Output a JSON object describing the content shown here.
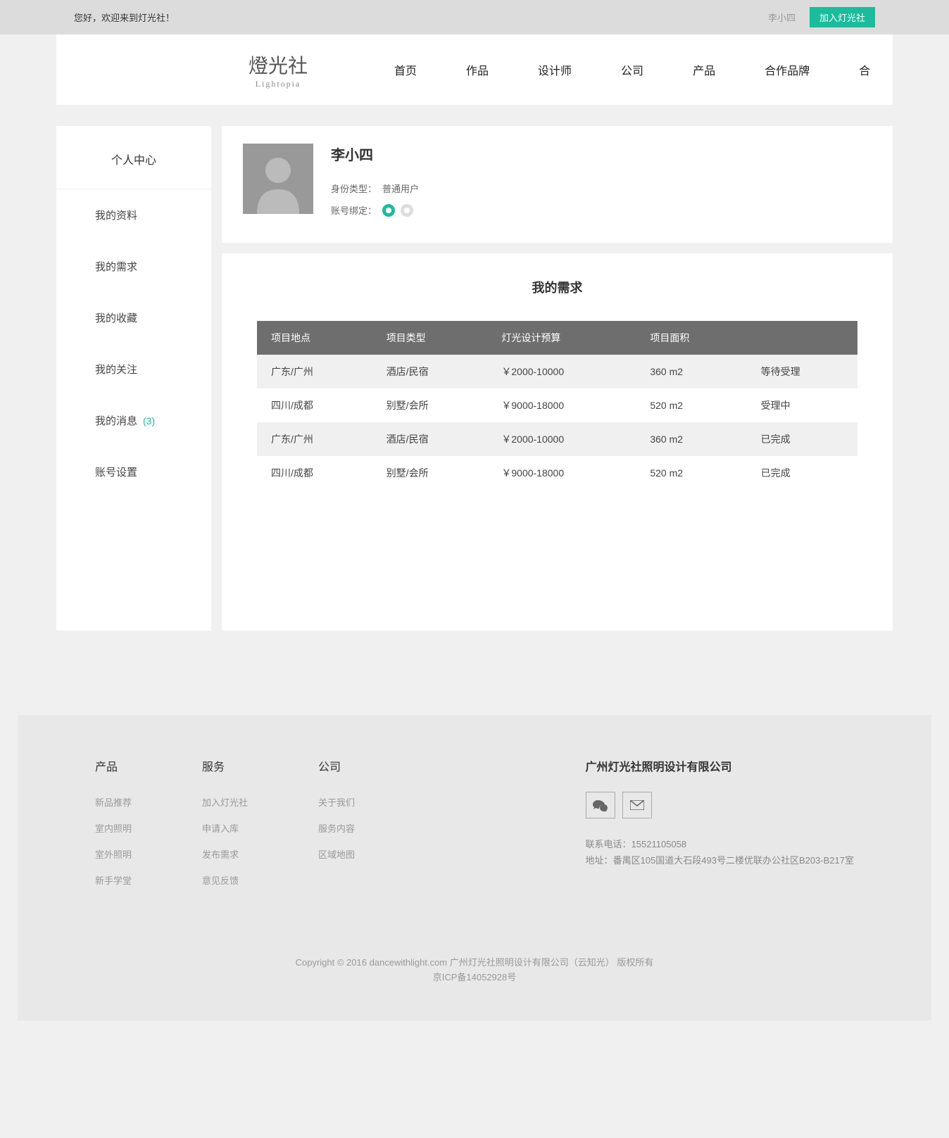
{
  "topbar": {
    "welcome": "您好，欢迎来到灯光社！",
    "username": "李小四",
    "join_btn": "加入灯光社"
  },
  "logo": {
    "main": "燈光社",
    "sub": "Lightopia"
  },
  "nav": [
    "首页",
    "作品",
    "设计师",
    "公司",
    "产品",
    "合作品牌",
    "合"
  ],
  "sidebar": {
    "title": "个人中心",
    "items": [
      {
        "label": "我的资料"
      },
      {
        "label": "我的需求"
      },
      {
        "label": "我的收藏"
      },
      {
        "label": "我的关注"
      },
      {
        "label": "我的消息",
        "badge": "(3)"
      },
      {
        "label": "账号设置"
      }
    ]
  },
  "profile": {
    "name": "李小四",
    "identity_label": "身份类型：",
    "identity_value": "普通用户",
    "bind_label": "账号绑定：",
    "bind_wechat": "wechat-icon",
    "bind_qq": "qq-icon"
  },
  "section_title": "我的需求",
  "table": {
    "headers": [
      "项目地点",
      "项目类型",
      "灯光设计预算",
      "项目面积",
      ""
    ],
    "rows": [
      {
        "location": "广东/广州",
        "type": "酒店/民宿",
        "budget": "￥2000-10000",
        "area": "360 m2",
        "status": "等待受理"
      },
      {
        "location": "四川/成都",
        "type": "别墅/会所",
        "budget": "￥9000-18000",
        "area": "520 m2",
        "status": "受理中"
      },
      {
        "location": "广东/广州",
        "type": "酒店/民宿",
        "budget": "￥2000-10000",
        "area": "360 m2",
        "status": "已完成"
      },
      {
        "location": "四川/成都",
        "type": "别墅/会所",
        "budget": "￥9000-18000",
        "area": "520 m2",
        "status": "已完成"
      }
    ]
  },
  "footer": {
    "cols": [
      {
        "title": "产品",
        "links": [
          "新品推荐",
          "室内照明",
          "室外照明",
          "新手学堂"
        ]
      },
      {
        "title": "服务",
        "links": [
          "加入灯光社",
          "申请入库",
          "发布需求",
          "意见反馈"
        ]
      },
      {
        "title": "公司",
        "links": [
          "关于我们",
          "服务内容",
          "区域地图"
        ]
      }
    ],
    "company": {
      "title": "广州灯光社照明设计有限公司",
      "phone_label": "联系电话：",
      "phone": "15521105058",
      "address_label": "地址：",
      "address": "番禺区105国道大石段493号二楼优联办公社区B203-B217室"
    },
    "copyright1": "Copyright © 2016 dancewithlight.com 广州灯光社照明设计有限公司（云知光） 版权所有",
    "copyright2": "京ICP备14052928号"
  }
}
